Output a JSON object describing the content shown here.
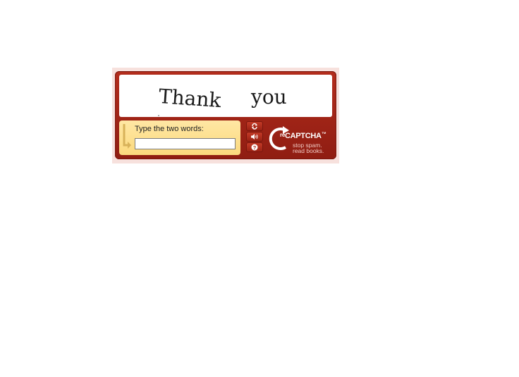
{
  "captcha": {
    "challenge_words": [
      "Thank",
      "you"
    ],
    "prompt": "Type the two words:",
    "answer_value": "",
    "buttons": {
      "reload_icon": "reload-icon",
      "audio_icon": "audio-icon",
      "help_icon": "help-icon"
    },
    "logo": {
      "prefix": "re",
      "name": "CAPTCHA",
      "trademark": "™",
      "tagline_line1": "stop spam.",
      "tagline_line2": "read books."
    },
    "colors": {
      "frame_bg": "#f7e1dd",
      "widget_red": "#a3261a",
      "input_panel": "#fde19a",
      "tagline": "#f0c9c2"
    }
  }
}
